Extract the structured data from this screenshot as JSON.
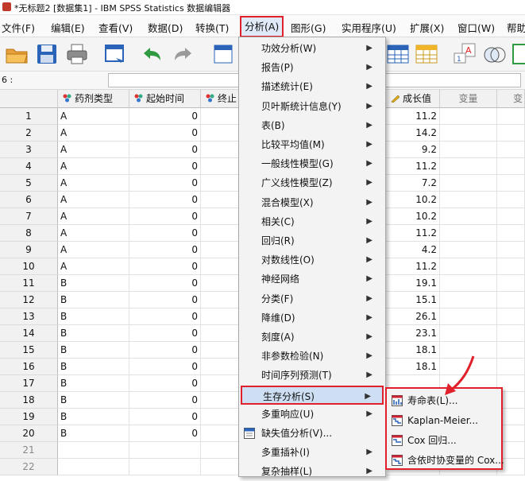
{
  "window": {
    "title": "*无标题2 [数据集1] - IBM SPSS Statistics 数据编辑器"
  },
  "menubar": [
    {
      "label": "文件(F)"
    },
    {
      "label": "编辑(E)"
    },
    {
      "label": "查看(V)"
    },
    {
      "label": "数据(D)"
    },
    {
      "label": "转换(T)"
    },
    {
      "label": "分析(A)"
    },
    {
      "label": "图形(G)"
    },
    {
      "label": "实用程序(U)"
    },
    {
      "label": "扩展(X)"
    },
    {
      "label": "窗口(W)"
    },
    {
      "label": "帮助"
    }
  ],
  "cell_editor": {
    "reference": "6 :",
    "value": ""
  },
  "columns": [
    "药剂类型",
    "起始时间",
    "终止",
    "成长值",
    "变量",
    "变"
  ],
  "rows": [
    {
      "n": "1",
      "drug": "A",
      "start": "0",
      "growth": "11.2"
    },
    {
      "n": "2",
      "drug": "A",
      "start": "0",
      "growth": "14.2"
    },
    {
      "n": "3",
      "drug": "A",
      "start": "0",
      "growth": "9.2"
    },
    {
      "n": "4",
      "drug": "A",
      "start": "0",
      "growth": "11.2"
    },
    {
      "n": "5",
      "drug": "A",
      "start": "0",
      "growth": "7.2"
    },
    {
      "n": "6",
      "drug": "A",
      "start": "0",
      "growth": "10.2"
    },
    {
      "n": "7",
      "drug": "A",
      "start": "0",
      "growth": "10.2"
    },
    {
      "n": "8",
      "drug": "A",
      "start": "0",
      "growth": "11.2"
    },
    {
      "n": "9",
      "drug": "A",
      "start": "0",
      "growth": "4.2"
    },
    {
      "n": "10",
      "drug": "A",
      "start": "0",
      "growth": "11.2"
    },
    {
      "n": "11",
      "drug": "B",
      "start": "0",
      "growth": "19.1"
    },
    {
      "n": "12",
      "drug": "B",
      "start": "0",
      "growth": "15.1"
    },
    {
      "n": "13",
      "drug": "B",
      "start": "0",
      "growth": "26.1"
    },
    {
      "n": "14",
      "drug": "B",
      "start": "0",
      "growth": "23.1"
    },
    {
      "n": "15",
      "drug": "B",
      "start": "0",
      "growth": "18.1"
    },
    {
      "n": "16",
      "drug": "B",
      "start": "0",
      "growth": "18.1"
    },
    {
      "n": "17",
      "drug": "B",
      "start": "0",
      "growth": ""
    },
    {
      "n": "18",
      "drug": "B",
      "start": "0",
      "growth": ""
    },
    {
      "n": "19",
      "drug": "B",
      "start": "0",
      "growth": ""
    },
    {
      "n": "20",
      "drug": "B",
      "start": "0",
      "growth": ""
    },
    {
      "n": "21",
      "drug": "",
      "start": "",
      "growth": ""
    },
    {
      "n": "22",
      "drug": "",
      "start": "",
      "growth": ""
    }
  ],
  "analyze_menu": [
    {
      "label": "功效分析(W)",
      "submenu": true
    },
    {
      "label": "报告(P)",
      "submenu": true
    },
    {
      "label": "描述统计(E)",
      "submenu": true
    },
    {
      "label": "贝叶斯统计信息(Y)",
      "submenu": true
    },
    {
      "label": "表(B)",
      "submenu": true
    },
    {
      "label": "比较平均值(M)",
      "submenu": true
    },
    {
      "label": "一般线性模型(G)",
      "submenu": true
    },
    {
      "label": "广义线性模型(Z)",
      "submenu": true
    },
    {
      "label": "混合模型(X)",
      "submenu": true
    },
    {
      "label": "相关(C)",
      "submenu": true
    },
    {
      "label": "回归(R)",
      "submenu": true
    },
    {
      "label": "对数线性(O)",
      "submenu": true
    },
    {
      "label": "神经网络",
      "submenu": true
    },
    {
      "label": "分类(F)",
      "submenu": true
    },
    {
      "label": "降维(D)",
      "submenu": true
    },
    {
      "label": "刻度(A)",
      "submenu": true
    },
    {
      "label": "非参数检验(N)",
      "submenu": true
    },
    {
      "label": "时间序列预测(T)",
      "submenu": true
    },
    {
      "label": "生存分析(S)",
      "submenu": true,
      "highlighted": true
    },
    {
      "label": "多重响应(U)",
      "submenu": true
    },
    {
      "label": "缺失值分析(V)...",
      "submenu": false,
      "icon": "missing-value-icon"
    },
    {
      "label": "多重插补(I)",
      "submenu": true
    },
    {
      "label": "复杂抽样(L)",
      "submenu": true
    }
  ],
  "survival_menu": [
    {
      "label": "寿命表(L)..."
    },
    {
      "label": "Kaplan-Meier..."
    },
    {
      "label": "Cox 回归..."
    },
    {
      "label": "含依时协变量的 Cox..."
    }
  ],
  "colors": {
    "highlight_border": "#e0202a",
    "menu_bg": "#f3f3f3",
    "selection": "#cfdff3"
  }
}
